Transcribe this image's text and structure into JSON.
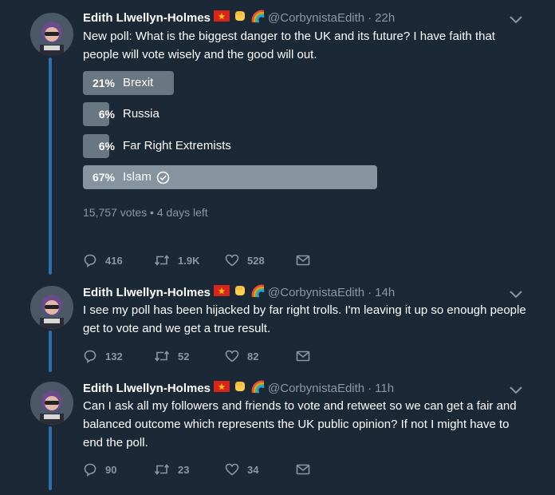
{
  "accent_color": "#2b6fb0",
  "background_color": "#1b2836",
  "tweets": [
    {
      "name": "Edith Llwellyn-Holmes",
      "handle": "@CorbynistaEdith",
      "time": "22h",
      "text": "New poll: What is the biggest danger to the UK and its future? I have faith that people will vote wisely and the good will out.",
      "poll": {
        "options": [
          {
            "percent_label": "21%",
            "label": "Brexit",
            "fraction": 0.21
          },
          {
            "percent_label": "6%",
            "label": "Russia",
            "fraction": 0.06
          },
          {
            "percent_label": "6%",
            "label": "Far Right Extremists",
            "fraction": 0.06
          },
          {
            "percent_label": "67%",
            "label": "Islam",
            "fraction": 0.67,
            "selected": true
          }
        ],
        "summary": "15,757 votes • 4 days left"
      },
      "replies": "416",
      "retweets": "1.9K",
      "likes": "528"
    },
    {
      "name": "Edith Llwellyn-Holmes",
      "handle": "@CorbynistaEdith",
      "time": "14h",
      "text": "I see my poll has been hijacked by far right trolls. I'm leaving it up so enough people get to vote and we get a true result.",
      "replies": "132",
      "retweets": "52",
      "likes": "82"
    },
    {
      "name": "Edith Llwellyn-Holmes",
      "handle": "@CorbynistaEdith",
      "time": "11h",
      "text": "Can I ask all my followers and friends to vote and retweet so we can get a fair and balanced outcome which represents the UK public opinion? If not I might have to end the poll.",
      "replies": "90",
      "retweets": "23",
      "likes": "34"
    }
  ]
}
